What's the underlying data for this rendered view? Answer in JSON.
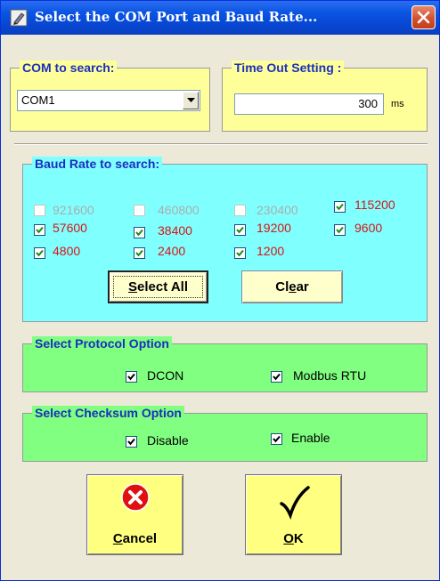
{
  "window": {
    "title": "Select the COM Port and Baud Rate...",
    "icons": {
      "app": "pencil-icon",
      "close": "close-icon"
    }
  },
  "com": {
    "legend": "COM to search:",
    "selected": "COM1"
  },
  "timeout": {
    "legend": "Time Out Setting :",
    "value": "300",
    "unit": "ms"
  },
  "baud": {
    "legend": "Baud Rate to search:",
    "rates": [
      {
        "label": "921600",
        "checked": false,
        "enabled": false
      },
      {
        "label": "460800",
        "checked": false,
        "enabled": false
      },
      {
        "label": "230400",
        "checked": false,
        "enabled": false
      },
      {
        "label": "115200",
        "checked": true,
        "enabled": true
      },
      {
        "label": "57600",
        "checked": true,
        "enabled": true
      },
      {
        "label": "38400",
        "checked": true,
        "enabled": true
      },
      {
        "label": "19200",
        "checked": true,
        "enabled": true
      },
      {
        "label": "9600",
        "checked": true,
        "enabled": true
      },
      {
        "label": "4800",
        "checked": true,
        "enabled": true
      },
      {
        "label": "2400",
        "checked": true,
        "enabled": true
      },
      {
        "label": "1200",
        "checked": true,
        "enabled": true
      }
    ],
    "select_all": {
      "pre": "",
      "hot": "S",
      "post": "elect  All"
    },
    "clear": {
      "pre": "Cl",
      "hot": "e",
      "post": "ar"
    }
  },
  "protocol": {
    "legend": "Select Protocol Option",
    "options": [
      {
        "label": "DCON",
        "checked": true
      },
      {
        "label": "Modbus RTU",
        "checked": true
      }
    ]
  },
  "checksum": {
    "legend": "Select Checksum  Option",
    "options": [
      {
        "label": "Disable",
        "checked": true
      },
      {
        "label": "Enable",
        "checked": true
      }
    ]
  },
  "buttons": {
    "cancel": {
      "hot": "C",
      "post": "ancel",
      "icon": "error-x-icon"
    },
    "ok": {
      "hot": "O",
      "post": "K",
      "icon": "checkmark-icon"
    }
  },
  "colors": {
    "title_bar": "#0a54e3",
    "yellow_panel": "#ffff99",
    "cyan_panel": "#80ffff",
    "green_panel": "#80ff80",
    "legend_text": "#1a2fbf",
    "rate_text": "#d81515"
  }
}
